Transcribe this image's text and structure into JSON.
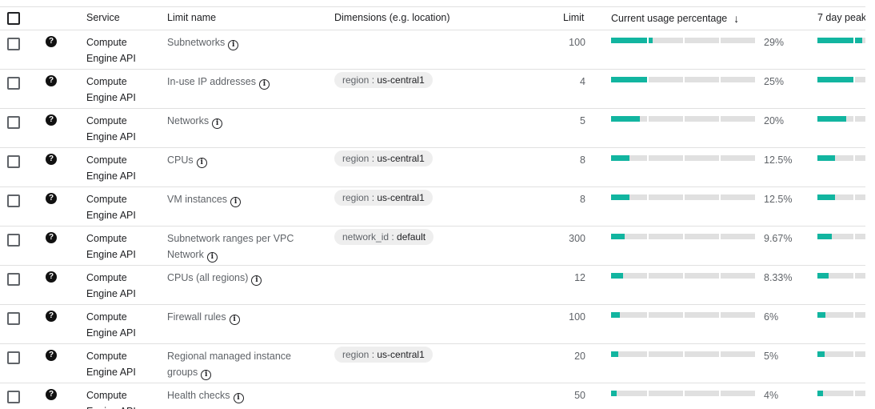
{
  "header": {
    "service": "Service",
    "limit_name": "Limit name",
    "dimensions": "Dimensions (e.g. location)",
    "limit": "Limit",
    "current_usage": "Current usage percentage",
    "peak": "7 day peak"
  },
  "colors": {
    "usage_fill": "#12b5a0",
    "track": "#e0e0e0"
  },
  "rows": [
    {
      "service": "Compute Engine API",
      "limit_name": "Subnetworks",
      "dim_key": "",
      "dim_value": "",
      "limit": "100",
      "pct_label": "29%",
      "usage_fraction": 0.29,
      "peak_fraction": 0.7
    },
    {
      "service": "Compute Engine API",
      "limit_name": "In-use IP addresses",
      "dim_key": "region",
      "dim_value": "us-central1",
      "limit": "4",
      "pct_label": "25%",
      "usage_fraction": 0.25,
      "peak_fraction": 0.56
    },
    {
      "service": "Compute Engine API",
      "limit_name": "Networks",
      "dim_key": "",
      "dim_value": "",
      "limit": "5",
      "pct_label": "20%",
      "usage_fraction": 0.2,
      "peak_fraction": 0.45
    },
    {
      "service": "Compute Engine API",
      "limit_name": "CPUs",
      "dim_key": "region",
      "dim_value": "us-central1",
      "limit": "8",
      "pct_label": "12.5%",
      "usage_fraction": 0.125,
      "peak_fraction": 0.28
    },
    {
      "service": "Compute Engine API",
      "limit_name": "VM instances",
      "dim_key": "region",
      "dim_value": "us-central1",
      "limit": "8",
      "pct_label": "12.5%",
      "usage_fraction": 0.125,
      "peak_fraction": 0.28
    },
    {
      "service": "Compute Engine API",
      "limit_name": "Subnetwork ranges per VPC Network",
      "dim_key": "network_id",
      "dim_value": "default",
      "limit": "300",
      "pct_label": "9.67%",
      "usage_fraction": 0.0967,
      "peak_fraction": 0.22
    },
    {
      "service": "Compute Engine API",
      "limit_name": "CPUs (all regions)",
      "dim_key": "",
      "dim_value": "",
      "limit": "12",
      "pct_label": "8.33%",
      "usage_fraction": 0.0833,
      "peak_fraction": 0.18
    },
    {
      "service": "Compute Engine API",
      "limit_name": "Firewall rules",
      "dim_key": "",
      "dim_value": "",
      "limit": "100",
      "pct_label": "6%",
      "usage_fraction": 0.06,
      "peak_fraction": 0.13
    },
    {
      "service": "Compute Engine API",
      "limit_name": "Regional managed instance groups",
      "dim_key": "region",
      "dim_value": "us-central1",
      "limit": "20",
      "pct_label": "5%",
      "usage_fraction": 0.05,
      "peak_fraction": 0.11
    },
    {
      "service": "Compute Engine API",
      "limit_name": "Health checks",
      "dim_key": "",
      "dim_value": "",
      "limit": "50",
      "pct_label": "4%",
      "usage_fraction": 0.04,
      "peak_fraction": 0.09
    }
  ]
}
